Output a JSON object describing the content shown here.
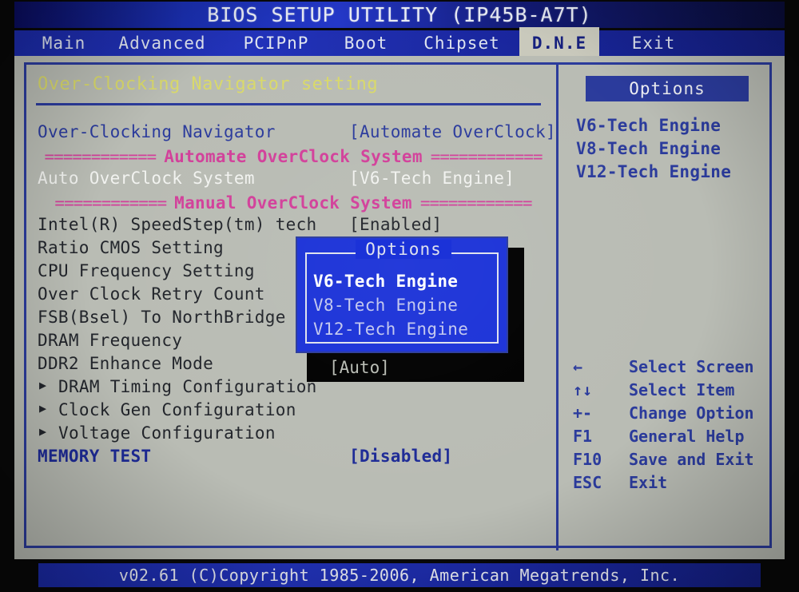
{
  "window": {
    "title": "BIOS SETUP UTILITY (IP45B-A7T)"
  },
  "tabs": [
    {
      "label": "Main",
      "active": false
    },
    {
      "label": "Advanced",
      "active": false
    },
    {
      "label": "PCIPnP",
      "active": false
    },
    {
      "label": "Boot",
      "active": false
    },
    {
      "label": "Chipset",
      "active": false
    },
    {
      "label": "D.N.E",
      "active": true
    },
    {
      "label": "Exit",
      "active": false
    }
  ],
  "main": {
    "page_title": "Over-Clocking Navigator setting",
    "rows": [
      {
        "label": "Over-Clocking Navigator",
        "value": "[Automate OverClock]",
        "style": "blue",
        "submenu": false
      },
      {
        "label": "Auto OverClock System",
        "value": "[V6-Tech Engine]",
        "style": "white",
        "submenu": false
      },
      {
        "label": "Intel(R) SpeedStep(tm) tech",
        "value": "[Enabled]",
        "style": "dark",
        "submenu": false
      },
      {
        "label": "Ratio CMOS Setting",
        "value": "",
        "style": "dark",
        "submenu": false
      },
      {
        "label": "CPU Frequency Setting",
        "value": "",
        "style": "dark",
        "submenu": false
      },
      {
        "label": "Over Clock Retry Count",
        "value": "",
        "style": "dark",
        "submenu": false
      },
      {
        "label": "FSB(Bsel) To NorthBridge La",
        "value": "",
        "style": "dark",
        "submenu": false
      },
      {
        "label": "DRAM Frequency",
        "value": "",
        "style": "dark",
        "submenu": false
      },
      {
        "label": "DDR2 Enhance Mode",
        "value": "",
        "style": "dark",
        "submenu": false
      },
      {
        "label": "DRAM Timing Configuration",
        "value": "",
        "style": "dark",
        "submenu": true
      },
      {
        "label": "Clock Gen   Configuration",
        "value": "",
        "style": "dark",
        "submenu": true
      },
      {
        "label": "Voltage Configuration",
        "value": "",
        "style": "dark",
        "submenu": true
      },
      {
        "label": "MEMORY TEST",
        "value": "[Disabled]",
        "style": "bluebold",
        "submenu": false
      }
    ],
    "separators": {
      "equals": "============",
      "auto_title": "Automate OverClock System",
      "manual_title": "Manual OverClock System"
    },
    "submenu_marker": "▶"
  },
  "options_panel": {
    "header": "Options",
    "items": [
      "V6-Tech Engine",
      "V8-Tech Engine",
      "V12-Tech Engine"
    ]
  },
  "help_legend": [
    {
      "key": "←",
      "desc": "Select Screen"
    },
    {
      "key": "↑↓",
      "desc": "Select Item"
    },
    {
      "key": "+-",
      "desc": "Change Option"
    },
    {
      "key": "F1",
      "desc": "General Help"
    },
    {
      "key": "F10",
      "desc": "Save and Exit"
    },
    {
      "key": "ESC",
      "desc": "Exit"
    }
  ],
  "popup": {
    "title": "Options",
    "items": [
      {
        "label": "V6-Tech Engine",
        "selected": true
      },
      {
        "label": "V8-Tech Engine",
        "selected": false
      },
      {
        "label": "V12-Tech Engine",
        "selected": false
      }
    ],
    "occluded_value": "[Auto]"
  },
  "footer": {
    "text": "v02.61 (C)Copyright 1985-2006, American Megatrends, Inc."
  },
  "colors": {
    "accent_blue": "#2b3b9c",
    "panel_gray": "#b9bcb4",
    "title_yellow": "#d9d96a",
    "separator_pink": "#d2409a",
    "popup_blue": "#1b32d8",
    "selected_white": "#f2f3f0"
  }
}
